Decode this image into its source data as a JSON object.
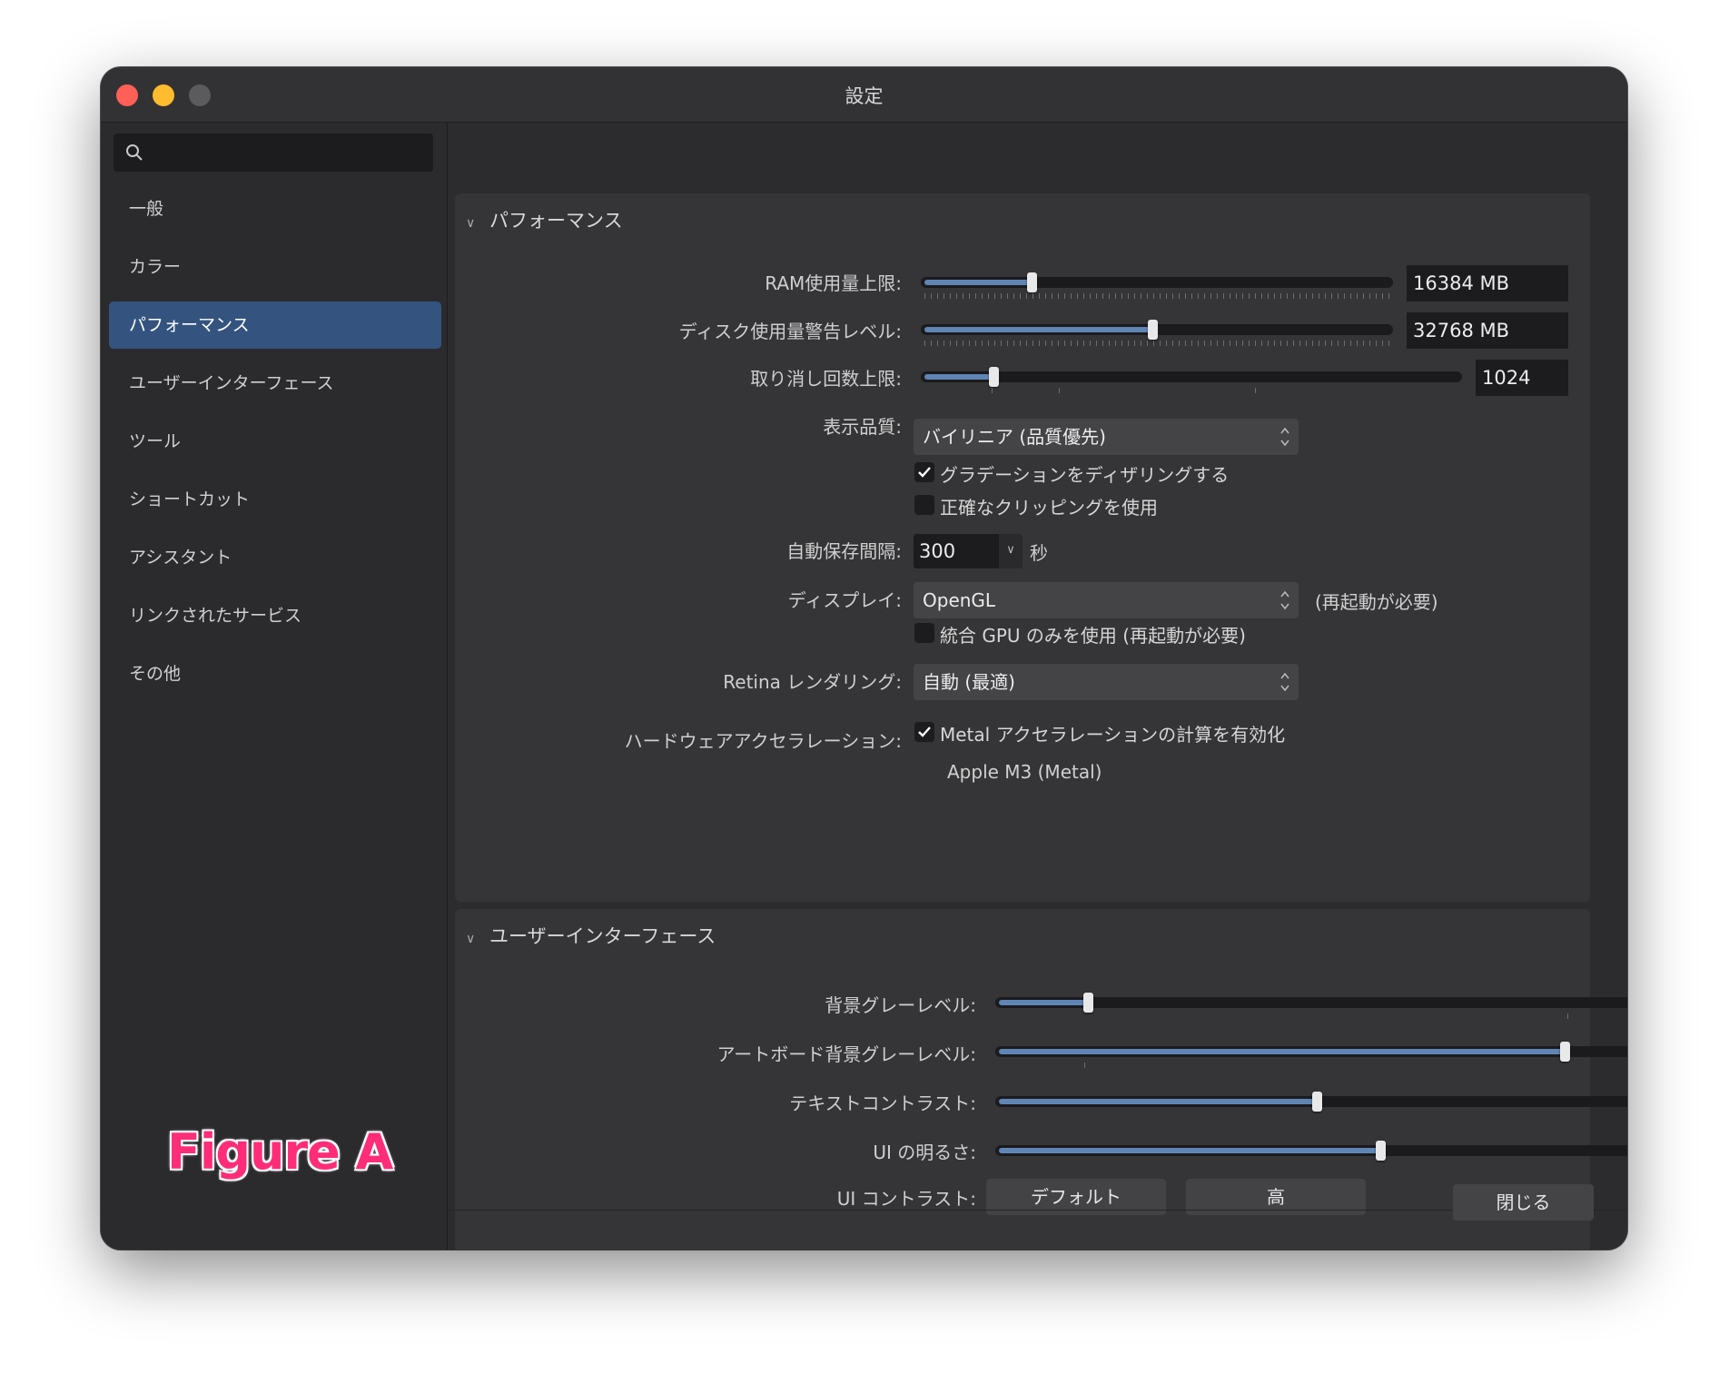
{
  "window": {
    "title": "設定"
  },
  "search": {
    "placeholder": ""
  },
  "sidebar": {
    "items": [
      {
        "label": "一般"
      },
      {
        "label": "カラー"
      },
      {
        "label": "パフォーマンス"
      },
      {
        "label": "ユーザーインターフェース"
      },
      {
        "label": "ツール"
      },
      {
        "label": "ショートカット"
      },
      {
        "label": "アシスタント"
      },
      {
        "label": "リンクされたサービス"
      },
      {
        "label": "その他"
      }
    ],
    "selected": "パフォーマンス"
  },
  "figure_label": "Figure A",
  "performance": {
    "title": "パフォーマンス",
    "ram": {
      "label": "RAM使用量上限:",
      "value": "16384 MB",
      "level": 0.23
    },
    "disk": {
      "label": "ディスク使用量警告レベル:",
      "value": "32768 MB",
      "level": 0.49
    },
    "undo": {
      "label": "取り消し回数上限:",
      "value": "1024",
      "level": 0.13
    },
    "quality": {
      "label": "表示品質:",
      "selected": "バイリニア (品質優先)"
    },
    "dither": {
      "label": "グラデーションをディザリングする",
      "checked": true
    },
    "clipping": {
      "label": "正確なクリッピングを使用",
      "checked": false
    },
    "autosave": {
      "label": "自動保存間隔:",
      "value": "300",
      "unit": "秒"
    },
    "display": {
      "label": "ディスプレイ:",
      "selected": "OpenGL",
      "note": "(再起動が必要)"
    },
    "integrated_gpu": {
      "label": "統合 GPU のみを使用 (再起動が必要)",
      "checked": false
    },
    "retina": {
      "label": "Retina レンダリング:",
      "selected": "自動 (最適)"
    },
    "hw_accel": {
      "label": "ハードウェアアクセラレーション:",
      "checkbox_label": "Metal アクセラレーションの計算を有効化",
      "checked": true,
      "device": "Apple M3 (Metal)"
    }
  },
  "ui": {
    "title": "ユーザーインターフェース",
    "bg_gray": {
      "label": "背景グレーレベル:",
      "level": 0.14
    },
    "artboard_gray": {
      "label": "アートボード背景グレーレベル:",
      "level": 0.89
    },
    "text_contrast": {
      "label": "テキストコントラスト:",
      "level": 0.5
    },
    "ui_brightness": {
      "label": "UI の明るさ:",
      "level": 0.6
    },
    "ui_contrast": {
      "label": "UI コントラスト:",
      "options": [
        "デフォルト",
        "高"
      ]
    }
  },
  "footer": {
    "close_label": "閉じる"
  },
  "colors": {
    "accent": "#34547f",
    "slider_fill": "#5f85b5",
    "close": "#fe5f57",
    "minimize": "#febc2e"
  }
}
